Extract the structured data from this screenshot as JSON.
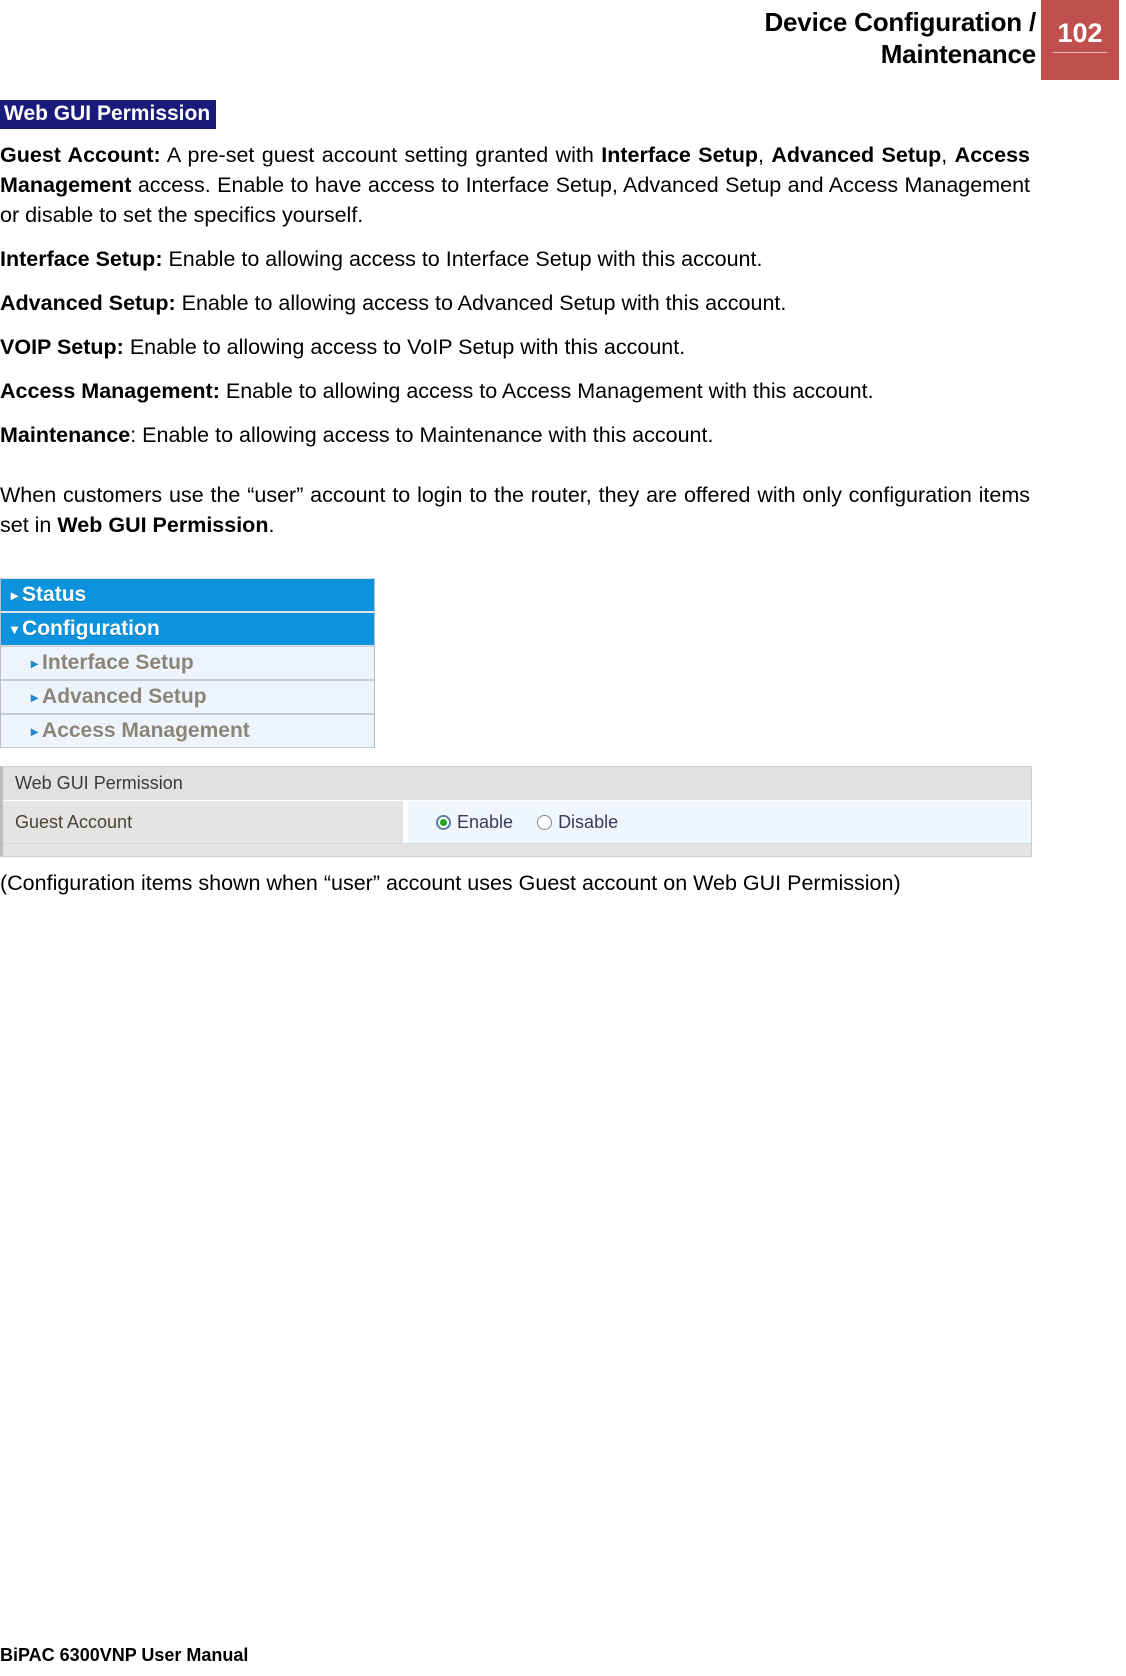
{
  "header": {
    "title_line1": "Device Configuration /",
    "title_line2": "Maintenance",
    "page_number": "102",
    "accent_color": "#c0504d"
  },
  "section": {
    "title": "Web GUI Permission",
    "title_bg": "#1a1a7a"
  },
  "paragraphs": {
    "guest_account_label": "Guest Account:",
    "guest_account_text_1": " A pre-set guest account setting granted with ",
    "guest_account_bold_1": "Interface Setup",
    "guest_account_text_2": ", ",
    "guest_account_bold_2": "Advanced Setup",
    "guest_account_text_3": ", ",
    "guest_account_bold_3": "Access Management",
    "guest_account_text_4": " access. Enable to have access to Interface Setup, Advanced Setup and Access Management or disable to set the specifics yourself.",
    "interface_setup_label": "Interface Setup:",
    "interface_setup_text": " Enable to allowing access to Interface Setup with this account.",
    "advanced_setup_label": "Advanced Setup:",
    "advanced_setup_text": " Enable to allowing access to Advanced Setup with this account.",
    "voip_setup_label": "VOIP Setup:",
    "voip_setup_text": " Enable to allowing access to VoIP Setup with this account.",
    "access_management_label": "Access Management:",
    "access_management_text": " Enable to allowing access to Access Management with this account.",
    "maintenance_label": "Maintenance",
    "maintenance_text": ": Enable to allowing access to Maintenance with this account.",
    "closing_text_1": "When customers use the “user” account to login to the router, they are offered with only configuration items set in ",
    "closing_bold": "Web GUI Permission",
    "closing_text_2": "."
  },
  "ui_menu": {
    "items": [
      {
        "label": "Status",
        "level": "top",
        "arrow": "▸",
        "expanded": false
      },
      {
        "label": "Configuration",
        "level": "top",
        "arrow": "▾",
        "expanded": true
      },
      {
        "label": "Interface Setup",
        "level": "sub",
        "arrow": "▸"
      },
      {
        "label": "Advanced Setup",
        "level": "sub",
        "arrow": "▸"
      },
      {
        "label": "Access Management",
        "level": "sub",
        "arrow": "▸"
      }
    ],
    "top_bg": "#0d93dd",
    "sub_bg": "#eef4fc"
  },
  "ui_panel": {
    "header": "Web GUI Permission",
    "row_label": "Guest Account",
    "option_enable": "Enable",
    "option_disable": "Disable",
    "selected": "Enable"
  },
  "caption": "(Configuration items shown when “user” account uses Guest account on Web GUI Permission)",
  "footer": {
    "text": "BiPAC 6300VNP User Manual"
  }
}
